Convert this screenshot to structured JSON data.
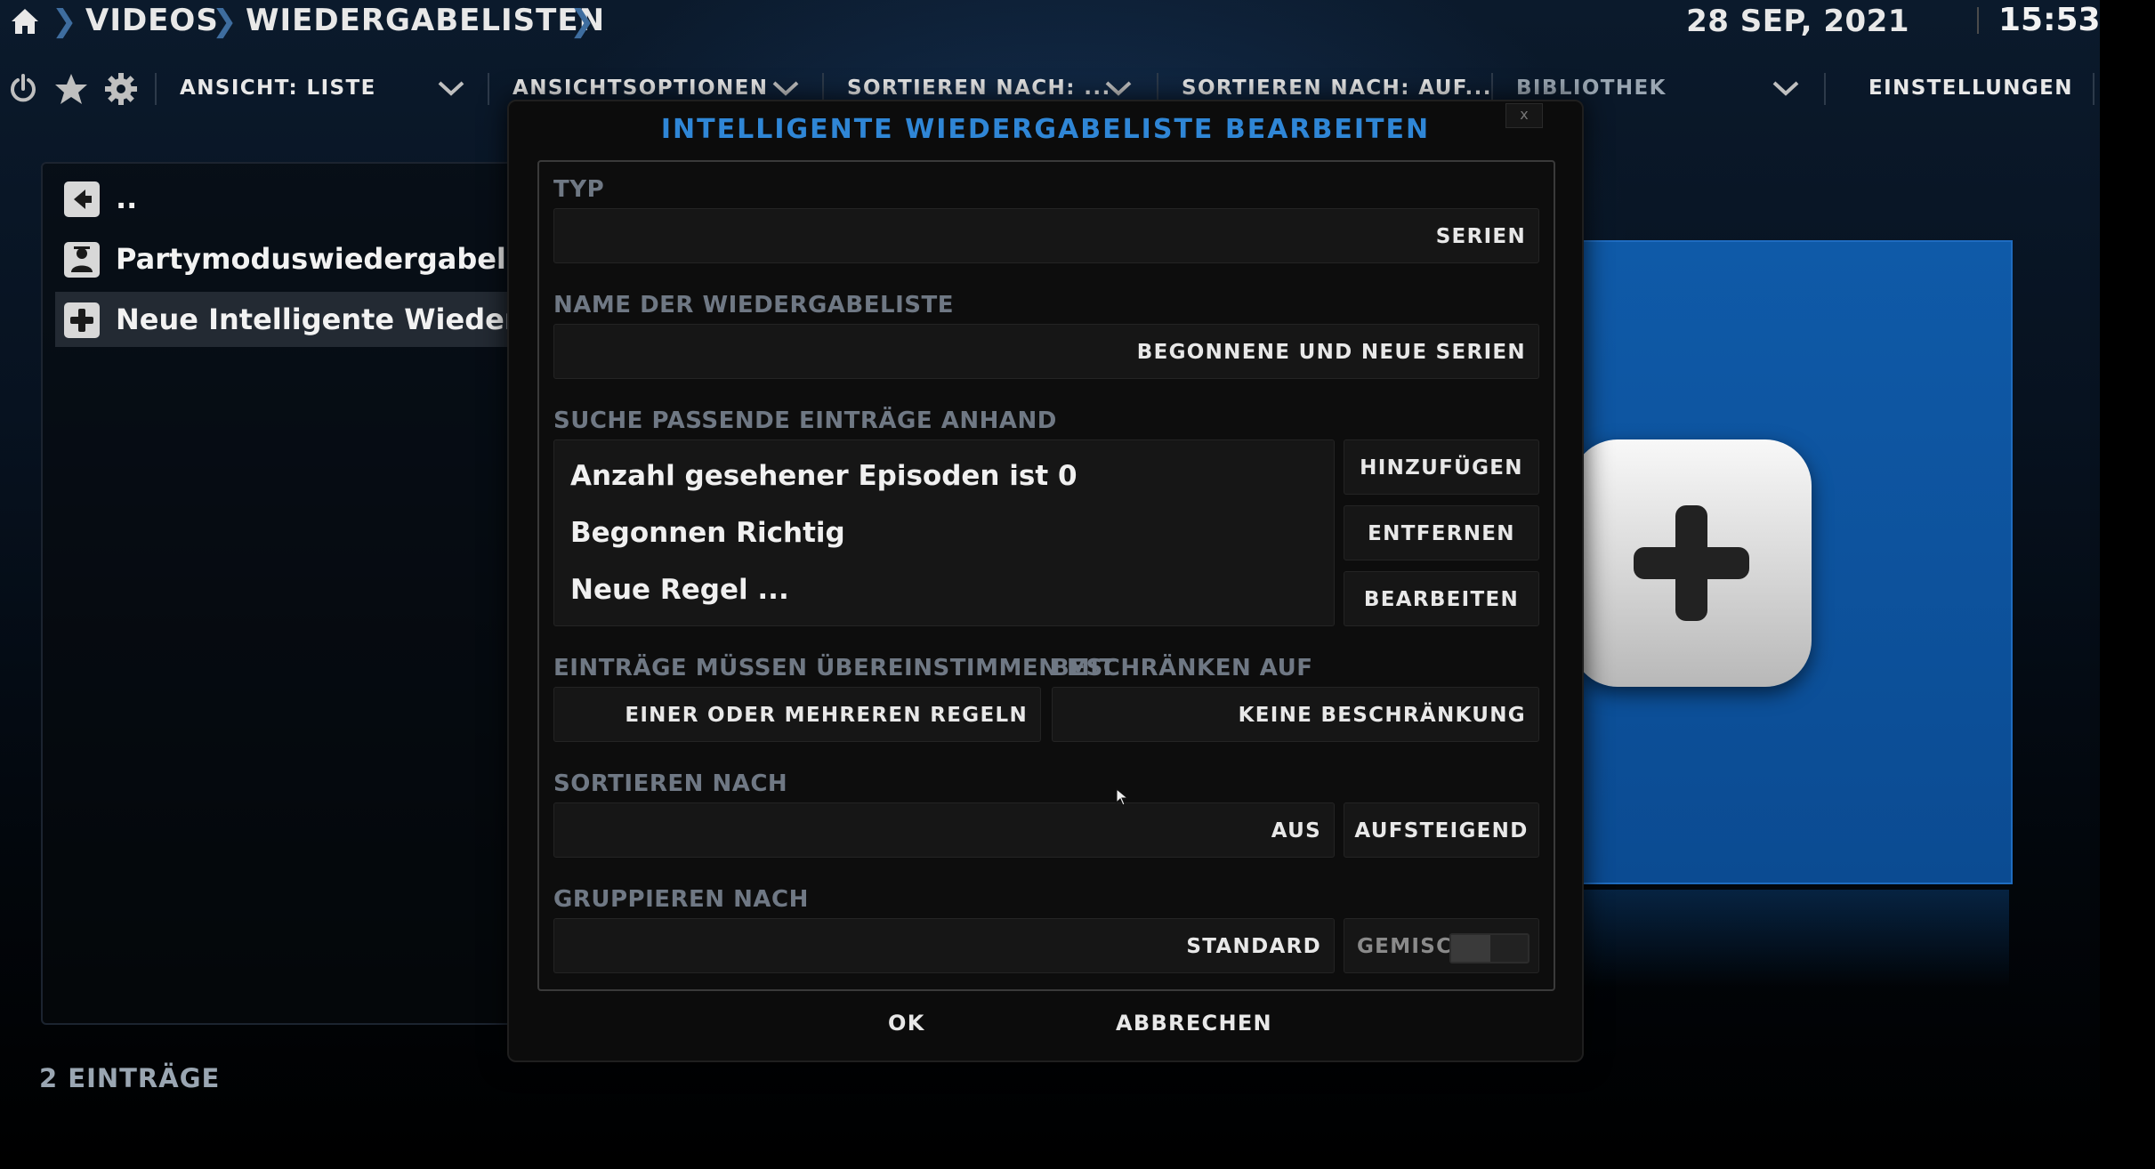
{
  "breadcrumb": {
    "items": [
      "VIDEOS",
      "WIEDERGABELISTEN"
    ]
  },
  "clock": {
    "date": "28 SEP, 2021",
    "time": "15:53"
  },
  "menu": {
    "view": "ANSICHT: LISTE",
    "view_options": "ANSICHTSOPTIONEN",
    "sort_by": "SORTIEREN NACH: ...",
    "sort_order": "SORTIEREN NACH: AUF...",
    "library": "BIBLIOTHEK",
    "settings": "EINSTELLUNGEN"
  },
  "list": {
    "items": [
      {
        "label": "..",
        "icon": "back-icon"
      },
      {
        "label": "Partymoduswiedergabeliste",
        "icon": "party-icon"
      },
      {
        "label": "Neue Intelligente Wiedergabeliste ...",
        "icon": "plus-icon"
      }
    ],
    "count": "2 EINTRÄGE"
  },
  "dialog": {
    "title": "INTELLIGENTE WIEDERGABELISTE BEARBEITEN",
    "close": "x",
    "type_label": "TYP",
    "type_value": "SERIEN",
    "name_label": "NAME DER WIEDERGABELISTE",
    "name_value": "BEGONNENE UND NEUE SERIEN",
    "rules_label": "SUCHE PASSENDE EINTRÄGE ANHAND",
    "rules": [
      "Anzahl gesehener Episoden ist 0",
      "Begonnen Richtig",
      "Neue Regel ..."
    ],
    "add_label": "HINZUFÜGEN",
    "remove_label": "ENTFERNEN",
    "edit_label": "BEARBEITEN",
    "match_label": "EINTRÄGE MÜSSEN ÜBEREINSTIMMEN MIT",
    "match_value": "EINER ODER MEHREREN REGELN",
    "limit_label": "BESCHRÄNKEN AUF",
    "limit_value": "KEINE BESCHRÄNKUNG",
    "sort_label": "SORTIEREN NACH",
    "sort_value": "AUS",
    "sort_direction": "AUFSTEIGEND",
    "group_label": "GRUPPIEREN NACH",
    "group_value": "STANDARD",
    "mixed_label": "GEMISCHT",
    "mixed_on": false,
    "ok_label": "OK",
    "cancel_label": "ABBRECHEN"
  },
  "colors": {
    "accent": "#2f86d6",
    "thumb": "#0f5aa8"
  }
}
